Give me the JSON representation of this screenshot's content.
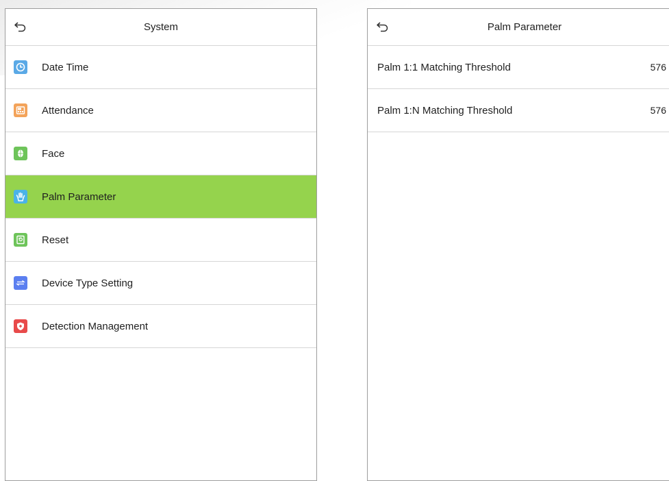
{
  "left_panel": {
    "title": "System",
    "items": [
      {
        "label": "Date Time",
        "icon": "clock-icon",
        "color": "#5aa9e6"
      },
      {
        "label": "Attendance",
        "icon": "attendance-icon",
        "color": "#f3a35a"
      },
      {
        "label": "Face",
        "icon": "face-icon",
        "color": "#6ec45a"
      },
      {
        "label": "Palm Parameter",
        "icon": "palm-icon",
        "color": "#4ab3e8",
        "active": true
      },
      {
        "label": "Reset",
        "icon": "reset-icon",
        "color": "#6ec45a"
      },
      {
        "label": "Device Type Setting",
        "icon": "device-type-icon",
        "color": "#5b7ff0"
      },
      {
        "label": "Detection Management",
        "icon": "shield-icon",
        "color": "#e84a4a"
      }
    ]
  },
  "right_panel": {
    "title": "Palm Parameter",
    "items": [
      {
        "label": "Palm 1:1 Matching Threshold",
        "value": "576"
      },
      {
        "label": "Palm 1:N Matching Threshold",
        "value": "576"
      }
    ]
  },
  "colors": {
    "active_row": "#95d34d",
    "divider": "#d6d6d6",
    "panel_border": "#9d9d9d"
  }
}
